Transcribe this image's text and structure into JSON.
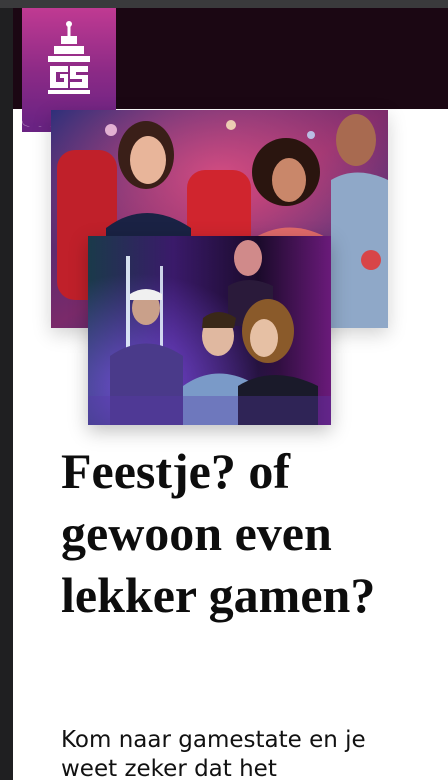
{
  "brand": {
    "logo_icon": "gamestate-gs-logo-icon",
    "colors": {
      "header": "#1b0713",
      "logo_gradient_top": "#c03a92",
      "logo_gradient_bottom": "#6a2383"
    }
  },
  "hero": {
    "back_photo": "arcade-friends-playing-photo",
    "front_photo": "arcade-gamers-neon-photo"
  },
  "content": {
    "headline": "Feestje? of gewoon even lekker gamen?",
    "subtext": "Kom naar gamestate en je weet zeker dat het"
  }
}
